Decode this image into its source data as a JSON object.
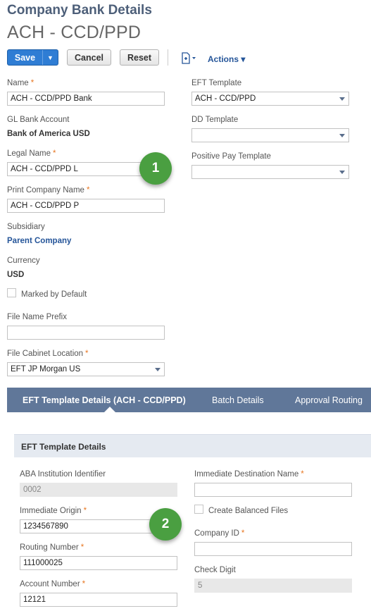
{
  "header": {
    "page_title": "Company Bank Details",
    "record_title": "ACH - CCD/PPD"
  },
  "toolbar": {
    "save_label": "Save",
    "save_menu_arrow": "▼",
    "cancel_label": "Cancel",
    "reset_label": "Reset",
    "new_record_icon": "document-plus-icon",
    "actions_label": "Actions",
    "actions_arrow": "▾"
  },
  "colors": {
    "title": "#4d5f79",
    "primary_button": "#2f7dd4",
    "link": "#255599",
    "required_marker": "#e87722",
    "tab_bar": "#607799",
    "badge": "#4a9f41"
  },
  "required_marker": "*",
  "primary_form": {
    "name": {
      "label": "Name",
      "value": "ACH - CCD/PPD Bank"
    },
    "gl_bank_account": {
      "label": "GL Bank Account",
      "value": "Bank of America USD"
    },
    "legal_name": {
      "label": "Legal Name",
      "value": "ACH - CCD/PPD L"
    },
    "print_company_name": {
      "label": "Print Company Name",
      "value": "ACH - CCD/PPD P"
    },
    "subsidiary": {
      "label": "Subsidiary",
      "value": "Parent Company"
    },
    "currency": {
      "label": "Currency",
      "value": "USD"
    },
    "marked_by_default": {
      "label": "Marked by Default",
      "checked": false
    },
    "file_name_prefix": {
      "label": "File Name Prefix",
      "value": ""
    },
    "file_cabinet_location": {
      "label": "File Cabinet Location",
      "value": "EFT JP Morgan US"
    },
    "eft_template": {
      "label": "EFT Template",
      "value": "ACH - CCD/PPD"
    },
    "dd_template": {
      "label": "DD Template",
      "value": ""
    },
    "positive_pay_template": {
      "label": "Positive Pay Template",
      "value": ""
    }
  },
  "callouts": [
    "1",
    "2"
  ],
  "tabs": [
    {
      "label": "EFT Template Details (ACH - CCD/PPD)",
      "active": true
    },
    {
      "label": "Batch Details",
      "active": false
    },
    {
      "label": "Approval Routing",
      "active": false
    }
  ],
  "eft_section": {
    "title": "EFT Template Details",
    "aba_institution_identifier": {
      "label": "ABA Institution Identifier",
      "value": "0002"
    },
    "immediate_origin": {
      "label": "Immediate Origin",
      "value": "1234567890"
    },
    "routing_number": {
      "label": "Routing Number",
      "value": "111000025"
    },
    "account_number": {
      "label": "Account Number",
      "value": "12121"
    },
    "immediate_destination_name": {
      "label": "Immediate Destination Name",
      "value": ""
    },
    "create_balanced_files": {
      "label": "Create Balanced Files",
      "checked": false
    },
    "company_id": {
      "label": "Company ID",
      "value": ""
    },
    "check_digit": {
      "label": "Check Digit",
      "value": "5"
    }
  }
}
